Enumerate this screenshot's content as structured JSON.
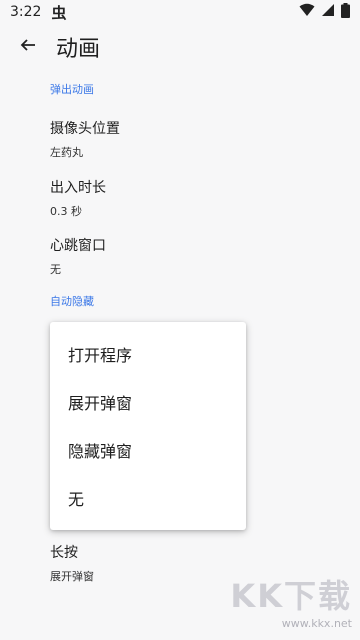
{
  "status": {
    "time": "3:22",
    "app_glyph": "虫"
  },
  "appbar": {
    "title": "动画"
  },
  "sections": [
    {
      "header": "弹出动画"
    },
    {
      "header": "自动隐藏"
    }
  ],
  "prefs": {
    "camera_position": {
      "title": "摄像头位置",
      "summary": "左药丸"
    },
    "duration": {
      "title": "出入时长",
      "summary": "0.3 秒"
    },
    "heartbeat": {
      "title": "心跳窗口",
      "summary": "无"
    },
    "long_press": {
      "title": "长按",
      "summary": "展开弹窗"
    }
  },
  "menu": {
    "items": [
      "打开程序",
      "展开弹窗",
      "隐藏弹窗",
      "无"
    ]
  },
  "watermark": {
    "big": "KK下载",
    "small": "www.kkx.net"
  },
  "colors": {
    "accent": "#3b78e7",
    "background": "#f7f7f8"
  }
}
